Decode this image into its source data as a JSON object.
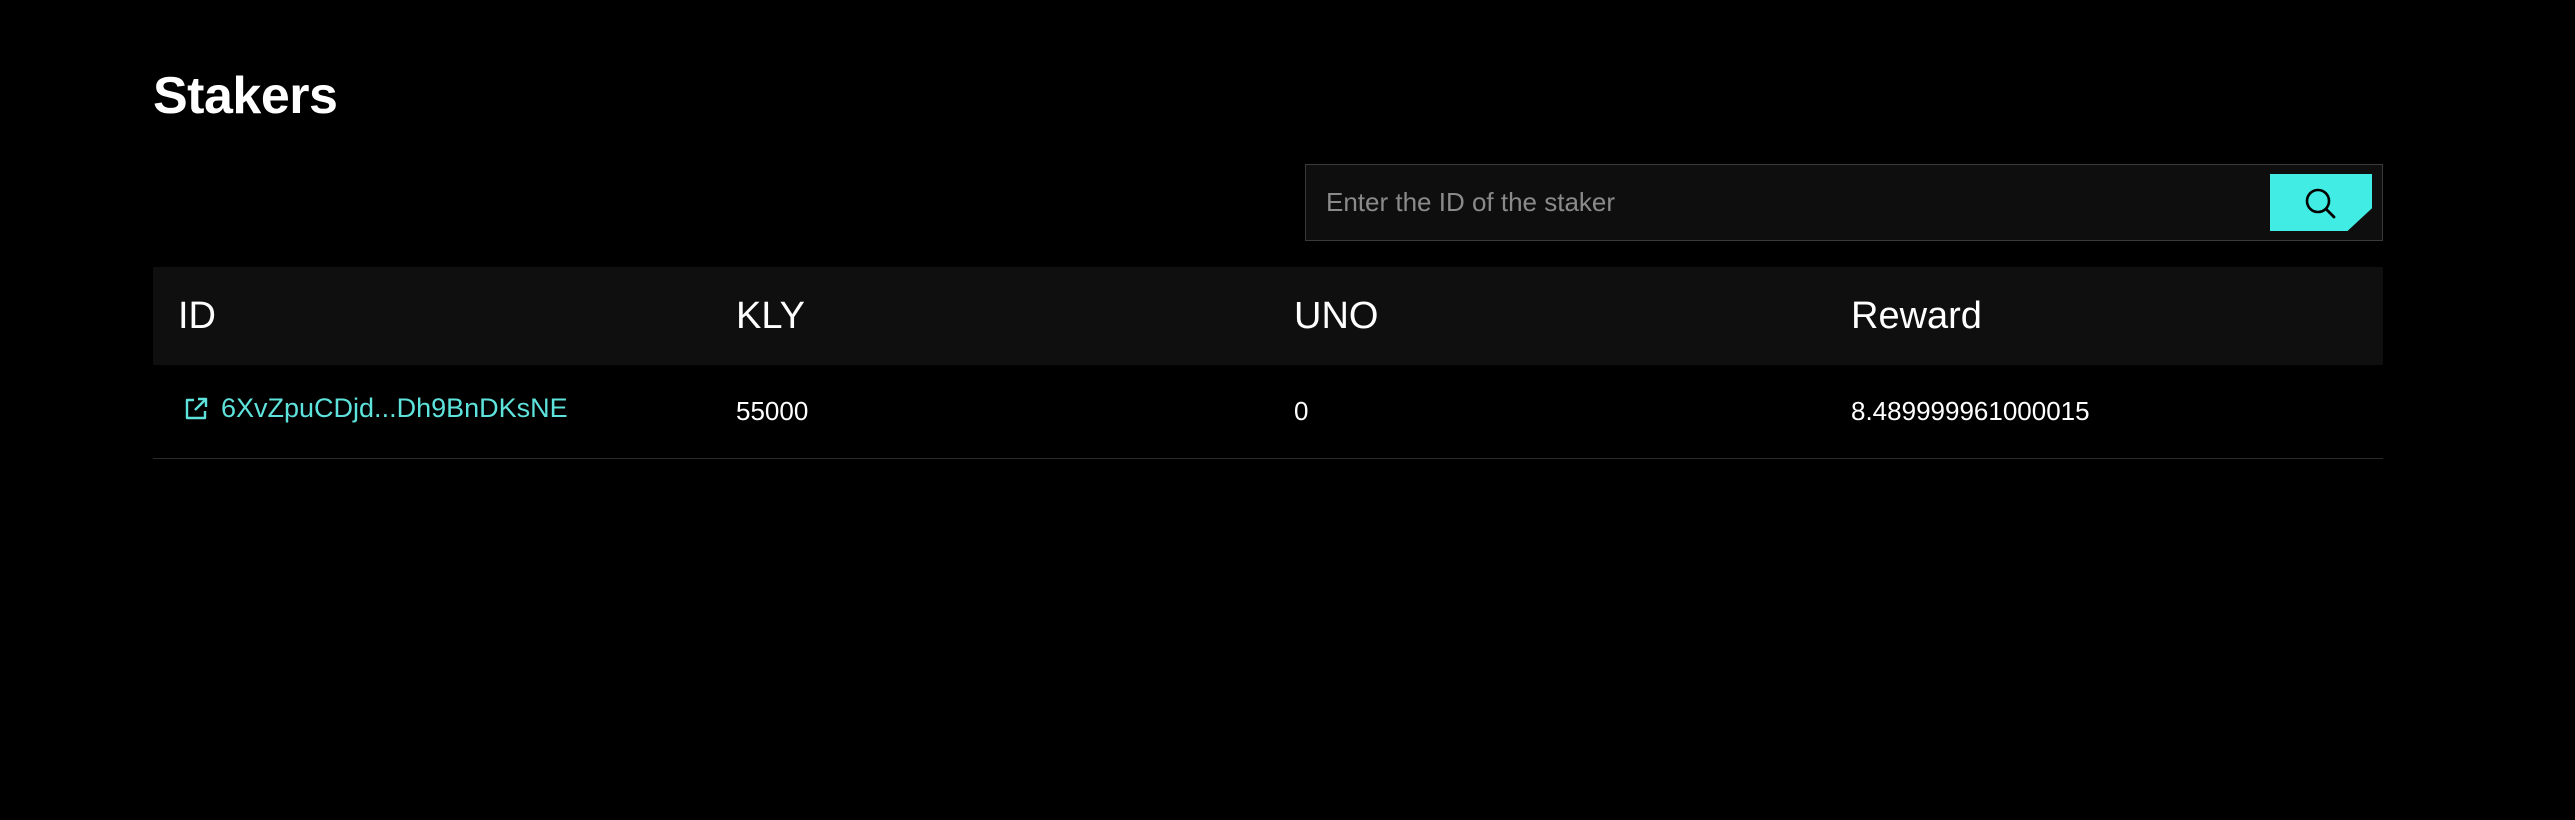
{
  "page": {
    "title": "Stakers"
  },
  "search": {
    "placeholder": "Enter the ID of the staker",
    "value": "",
    "button_icon": "search-icon",
    "accent_color": "#40ece3"
  },
  "table": {
    "columns": [
      "ID",
      "KLY",
      "UNO",
      "Reward"
    ],
    "rows": [
      {
        "id": "6XvZpuCDjd...Dh9BnDKsNE",
        "id_icon": "external-link-icon",
        "kly": "55000",
        "uno": "0",
        "reward": "8.489999961000015"
      }
    ]
  },
  "colors": {
    "background": "#000000",
    "header_background": "#0f0f0f",
    "link": "#5ee3dc"
  }
}
